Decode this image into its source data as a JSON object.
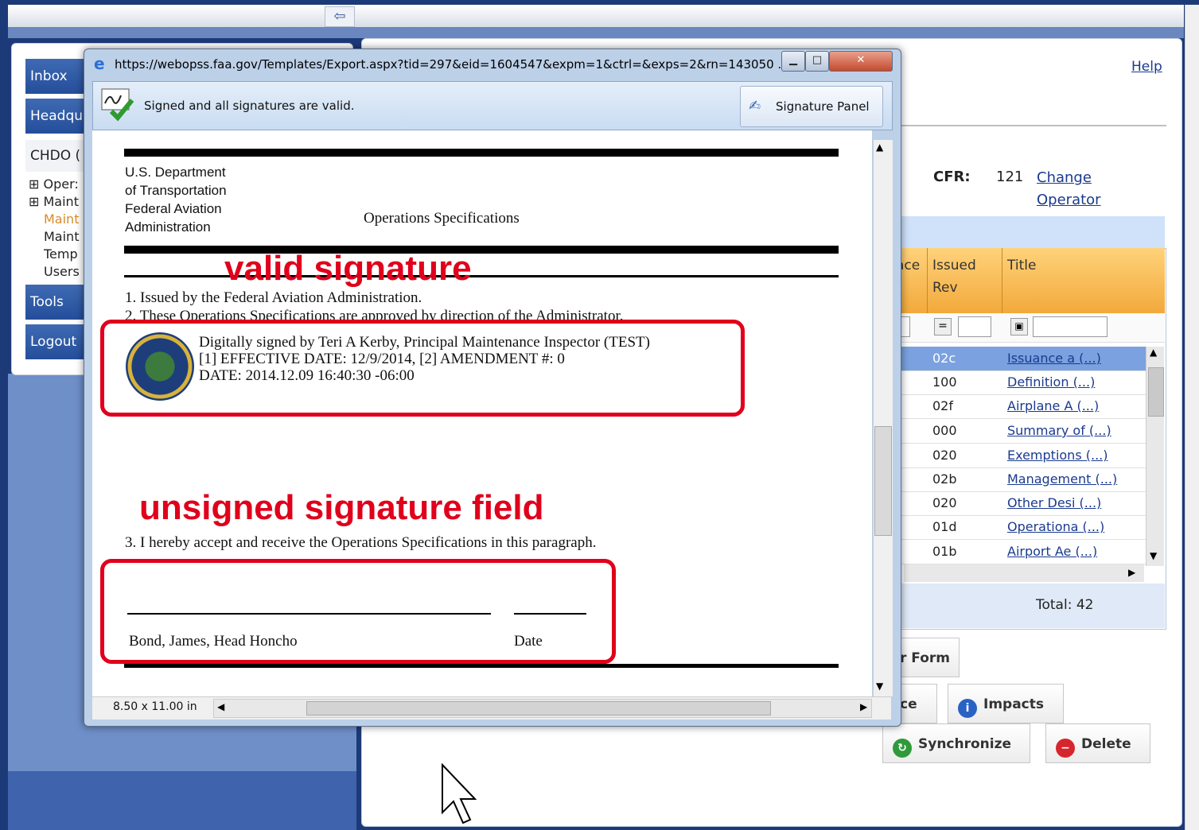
{
  "topbar": {
    "back_icon": "back-arrow-icon",
    "back_glyph": "⇦"
  },
  "nav": {
    "inbox": "Inbox",
    "headquarters": "Headqu",
    "chdo": "CHDO (",
    "tools": "Tools",
    "logout": "Logout",
    "tree": [
      "⊞ Oper:",
      "⊞ Maint",
      "Maint",
      "Maint",
      "Temp",
      "Users"
    ]
  },
  "main": {
    "help": "Help",
    "cfr_label": "CFR:",
    "cfr_value": "121",
    "change_operator": "Change Operator",
    "grid": {
      "headers": [
        "ace",
        "Issued Rev",
        "Title"
      ],
      "rows": [
        {
          "rev": "02c",
          "title": "Issuance a (...)"
        },
        {
          "rev": "100",
          "title": "Definition (...)"
        },
        {
          "rev": "02f",
          "title": "Airplane A (...)"
        },
        {
          "rev": "000",
          "title": "Summary of (...)"
        },
        {
          "rev": "020",
          "title": "Exemptions (...)"
        },
        {
          "rev": "02b",
          "title": "Management (...)"
        },
        {
          "rev": "020",
          "title": "Other Desi (...)"
        },
        {
          "rev": "01d",
          "title": "Operationa (...)"
        },
        {
          "rev": "01b",
          "title": "Airport Ae (...)"
        }
      ],
      "total": "Total: 42"
    },
    "buttons": {
      "form": "r Form",
      "ce": "ce",
      "impacts": "Impacts",
      "synchronize": "Synchronize",
      "delete": "Delete"
    }
  },
  "popup": {
    "title": "https://webopss.faa.gov/Templates/Export.aspx?tid=297&eid=1604547&expm=1&ctrl=&exps=2&rn=143050 ...",
    "sig_status": "Signed and all signatures are valid.",
    "sig_panel": "Signature Panel",
    "page_size": "8.50 x 11.00 in",
    "doc": {
      "agency_lines": [
        "U.S. Department",
        "of Transportation",
        "Federal Aviation",
        "Administration"
      ],
      "heading": "Operations Specifications",
      "para1": "1. Issued by the Federal Aviation Administration.",
      "para2": "2. These Operations Specifications are approved by direction of the Administrator.",
      "sig_line1": "Digitally signed by Teri A Kerby, Principal Maintenance Inspector (TEST)",
      "sig_line2": "[1] EFFECTIVE DATE: 12/9/2014, [2] AMENDMENT #: 0",
      "sig_line3": "DATE: 2014.12.09 16:40:30 -06:00",
      "para3": "3. I hereby accept and receive the Operations Specifications in this paragraph.",
      "signer": "Bond, James, Head Honcho",
      "date_label": "Date"
    }
  },
  "annotations": {
    "valid": "valid signature",
    "unsigned": "unsigned signature field"
  },
  "colors": {
    "annotation_red": "#e0001b",
    "nav_blue": "#244e9a",
    "grid_header_orange": "#f2a93b"
  }
}
